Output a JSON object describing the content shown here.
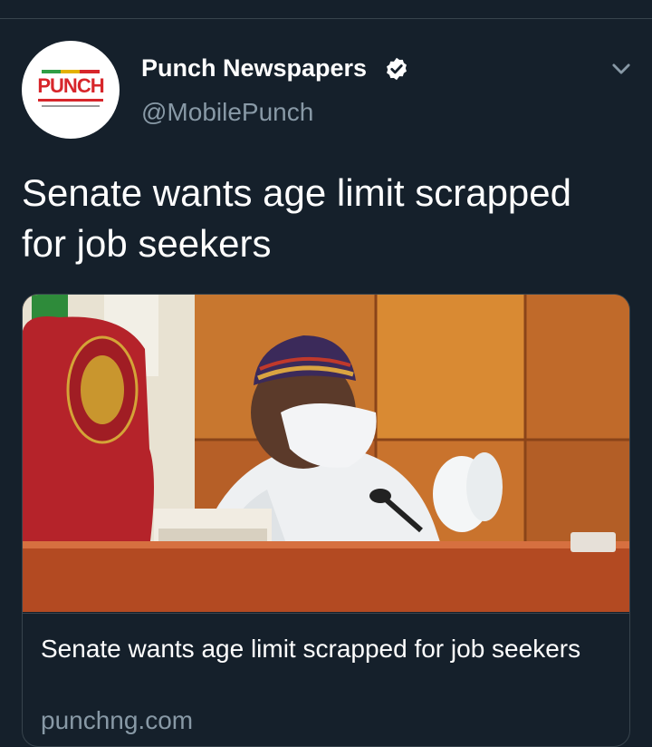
{
  "author": {
    "display_name": "Punch Newspapers",
    "handle": "@MobilePunch",
    "avatar_text": "PUNCH",
    "verified": true
  },
  "tweet": {
    "text": "Senate wants age limit scrapped for job seekers"
  },
  "card": {
    "title": "Senate wants age limit scrapped for job seekers",
    "domain": "punchng.com"
  },
  "icons": {
    "verified": "verified-badge-icon",
    "more": "chevron-down-icon"
  },
  "colors": {
    "background": "#15202b",
    "secondary_text": "#8899a6",
    "border": "#38444d",
    "brand": "#d7262b"
  }
}
